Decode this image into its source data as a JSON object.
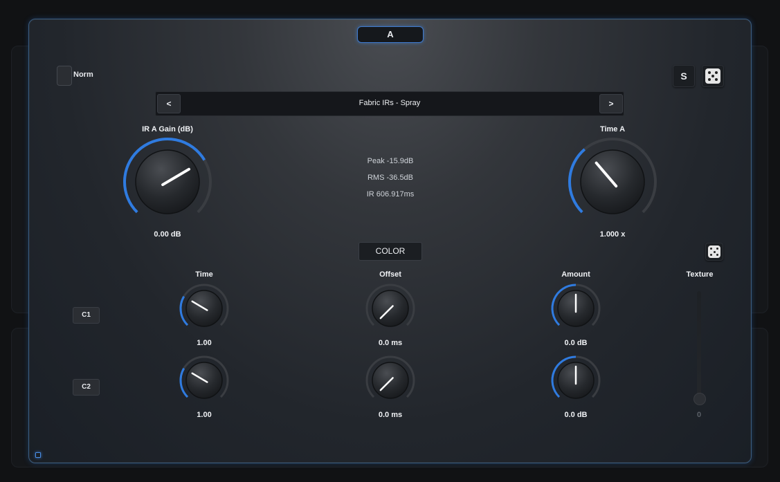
{
  "tab": {
    "label": "A"
  },
  "norm": {
    "label": "Norm",
    "checked": false
  },
  "solo_button": {
    "label": "S"
  },
  "dice_icon": "dice-icon",
  "preset": {
    "prev_label": "<",
    "next_label": ">",
    "name": "Fabric IRs - Spray"
  },
  "ir_gain": {
    "label": "IR A Gain (dB)",
    "value": "0.00 dB",
    "level": 0.72
  },
  "time_a": {
    "label": "Time A",
    "value": "1.000 x",
    "level": 0.35
  },
  "meters": {
    "peak": "Peak -15.9dB",
    "rms": "RMS -36.5dB",
    "ir": "IR 606.917ms"
  },
  "color_button": {
    "label": "COLOR"
  },
  "columns": {
    "time": "Time",
    "offset": "Offset",
    "amount": "Amount",
    "texture": "Texture"
  },
  "rows": [
    {
      "label": "C1",
      "time": "1.00",
      "offset": "0.0 ms",
      "amount": "0.0 dB",
      "time_level": 0.28,
      "offset_level": 0.0,
      "amount_level": 0.5
    },
    {
      "label": "C2",
      "time": "1.00",
      "offset": "0.0 ms",
      "amount": "0.0 dB",
      "time_level": 0.28,
      "offset_level": 0.0,
      "amount_level": 0.5
    }
  ],
  "texture": {
    "value": "0",
    "level": 0.0
  },
  "colors": {
    "accent": "#2f7be0",
    "panel_border": "#3b5d80"
  }
}
